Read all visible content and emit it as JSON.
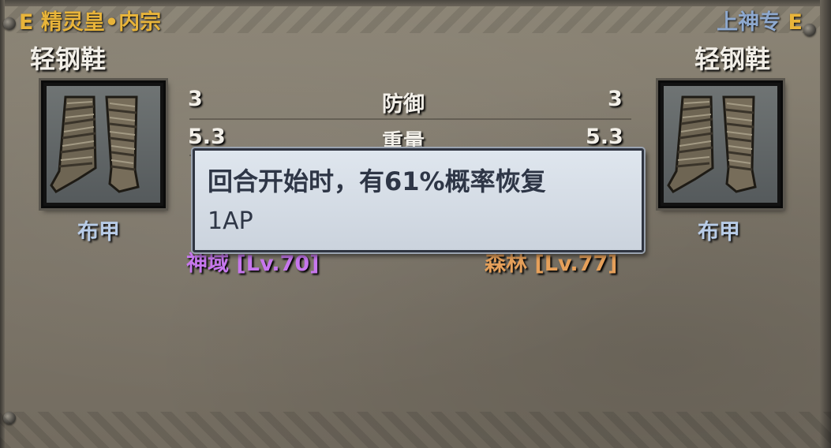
{
  "left_item": {
    "grade": "E",
    "source": "精灵皇•内宗",
    "name": "轻钢鞋",
    "armor_type": "布甲",
    "zone": "神域",
    "zone_level": "[Lv.70]",
    "icon": "wrapped-boots-icon"
  },
  "right_item": {
    "grade": "E",
    "source": "上神专",
    "name": "轻钢鞋",
    "armor_type": "布甲",
    "zone": "森林",
    "zone_level": "[Lv.77]",
    "icon": "wrapped-boots-icon"
  },
  "stats": [
    {
      "label": "防御",
      "left": "3",
      "right": "3"
    },
    {
      "label": "重量",
      "left": "5.3",
      "right": "5.3"
    }
  ],
  "tooltip": {
    "line1": "回合开始时，有61%概率恢复",
    "line2": "1AP"
  },
  "colors": {
    "grade": "#e8b43a",
    "left_zone": "#c777ee",
    "right_zone": "#e6a05a",
    "armor_type": "#b8cce8",
    "right_source": "#8ea9cf"
  }
}
